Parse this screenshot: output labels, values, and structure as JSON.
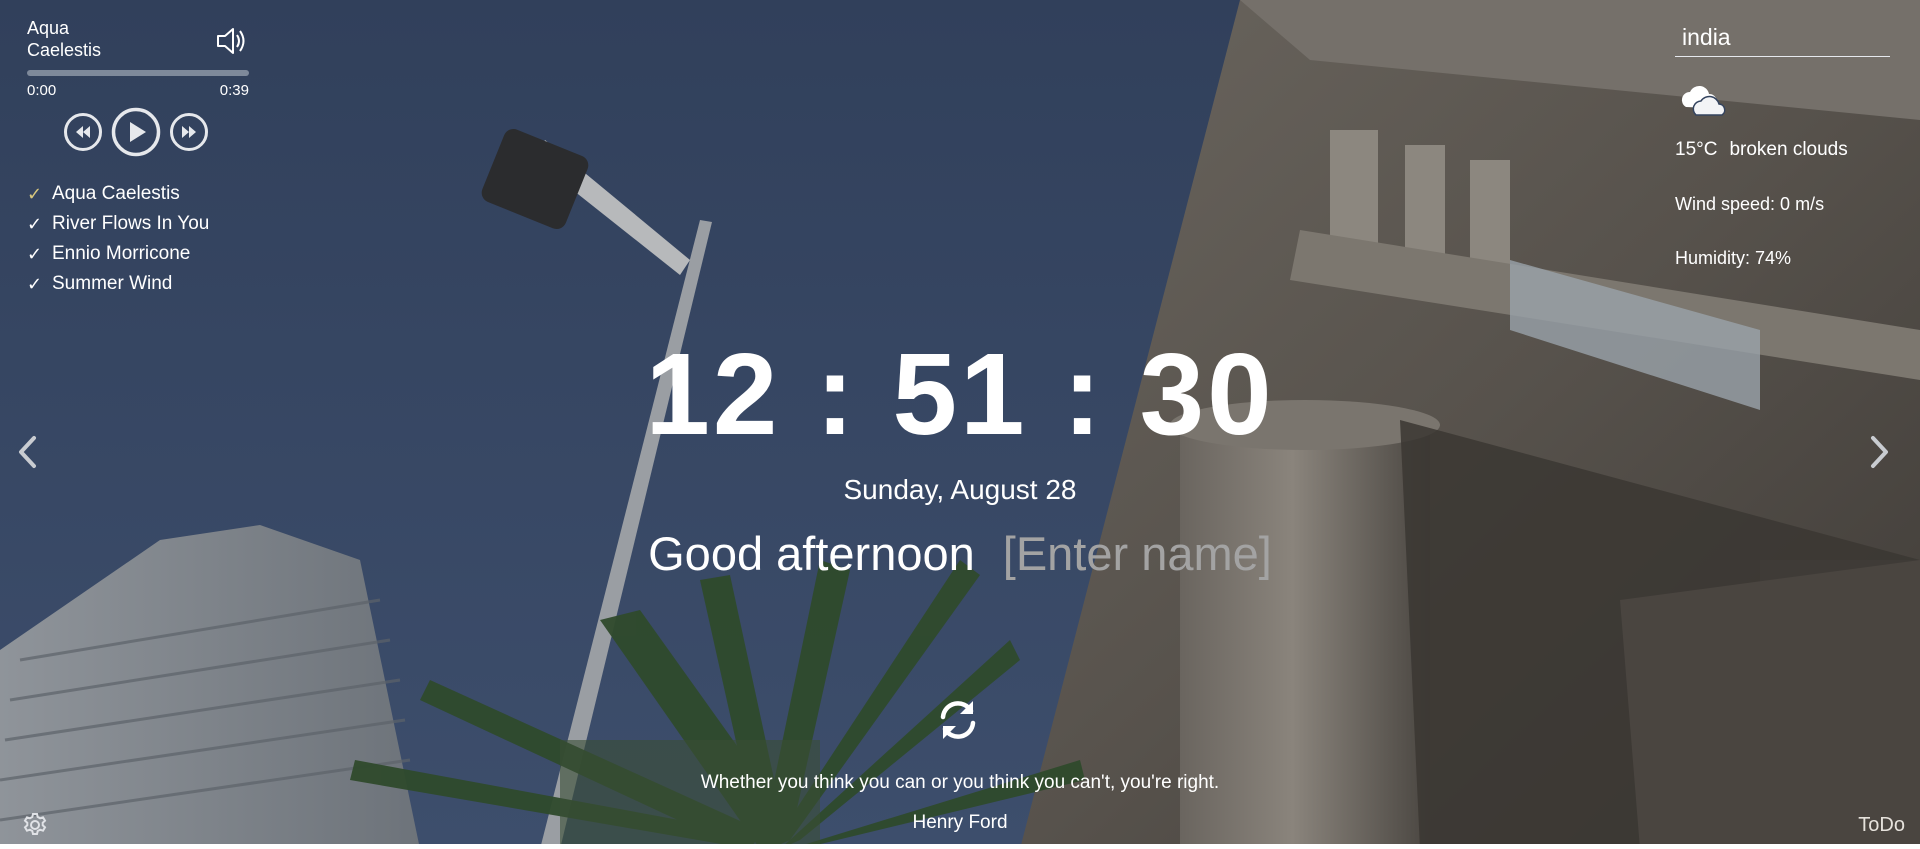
{
  "player": {
    "track_title": "Aqua Caelestis",
    "current_time": "0:00",
    "duration": "0:39",
    "progress_fraction": 0,
    "volume_icon": "speaker-icon",
    "controls": {
      "prev_icon": "rewind-icon",
      "play_icon": "play-icon",
      "next_icon": "fast-forward-icon"
    },
    "playlist": [
      {
        "title": "Aqua Caelestis",
        "active": true
      },
      {
        "title": "River Flows In You",
        "active": false
      },
      {
        "title": "Ennio Morricone",
        "active": false
      },
      {
        "title": "Summer Wind",
        "active": false
      }
    ],
    "check_glyph": "✓",
    "active_check_color": "#d8c77e"
  },
  "weather": {
    "city": "india",
    "icon": "broken-clouds-icon",
    "temperature": "15°C",
    "description": "broken clouds",
    "wind": "Wind speed: 0 m/s",
    "humidity": "Humidity: 74%"
  },
  "clock": {
    "time": "12 : 51 : 30",
    "date": "Sunday, August 28"
  },
  "greeting": {
    "text": "Good afternoon",
    "name_placeholder": "[Enter name]"
  },
  "quote": {
    "text": "Whether you think you can or you think you can't, you're right.",
    "author": "Henry Ford",
    "refresh_icon": "refresh-icon"
  },
  "navigation": {
    "prev_icon": "chevron-left-icon",
    "next_icon": "chevron-right-icon"
  },
  "footer": {
    "settings_icon": "gear-icon",
    "todo_label": "ToDo"
  },
  "colors": {
    "sky": "#34445f",
    "text": "#ffffff",
    "placeholder": "#a3a3a3"
  }
}
